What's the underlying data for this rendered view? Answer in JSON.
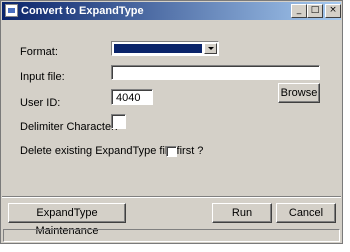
{
  "window": {
    "title": "Convert to ExpandType",
    "icon": "app-icon",
    "caption_buttons": {
      "minimize": "_",
      "maximize": "□",
      "close": "×"
    }
  },
  "form": {
    "format_label": "Format:",
    "format_selected": "",
    "input_file_label": "Input file:",
    "input_file_value": "",
    "browse_label": "Browse",
    "user_id_label": "User ID:",
    "user_id_value": "4040",
    "delimiter_label": "Delimiter Character:",
    "delimiter_value": "",
    "delete_existing_label": "Delete existing ExpandType file first ?",
    "delete_existing_checked": false
  },
  "footer": {
    "maintenance_label": "ExpandType Maintenance",
    "run_label": "Run",
    "cancel_label": "Cancel"
  },
  "status_bar": {
    "text": ""
  },
  "colors": {
    "title_start": "#0a246a",
    "title_end": "#a6caf0",
    "face": "#d4d0c8",
    "selection": "#0a246a"
  }
}
